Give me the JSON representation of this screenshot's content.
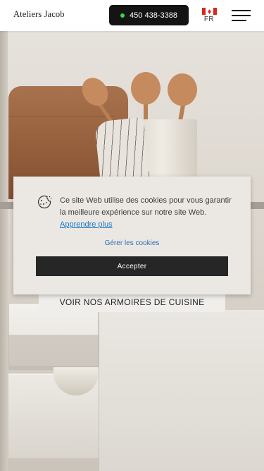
{
  "header": {
    "logo": "Ateliers Jacob",
    "phone": "450 438-3388",
    "language": "FR",
    "flag_icon": "canada-flag-icon",
    "menu_icon": "hamburger-menu-icon"
  },
  "hero": {
    "cta_label": "VOIR NOS ARMOIRES DE CUISINE"
  },
  "cookie_banner": {
    "icon": "cookie-icon",
    "message": "Ce site Web utilise des cookies pour vous garantir la meilleure expérience sur notre site Web.",
    "learn_more": "Apprendre plus",
    "manage_label": "Gérer les cookies",
    "accept_label": "Accepter"
  },
  "colors": {
    "phone_status": "#3bd44a",
    "link": "#1f78c6",
    "accept_bg": "#262626"
  }
}
